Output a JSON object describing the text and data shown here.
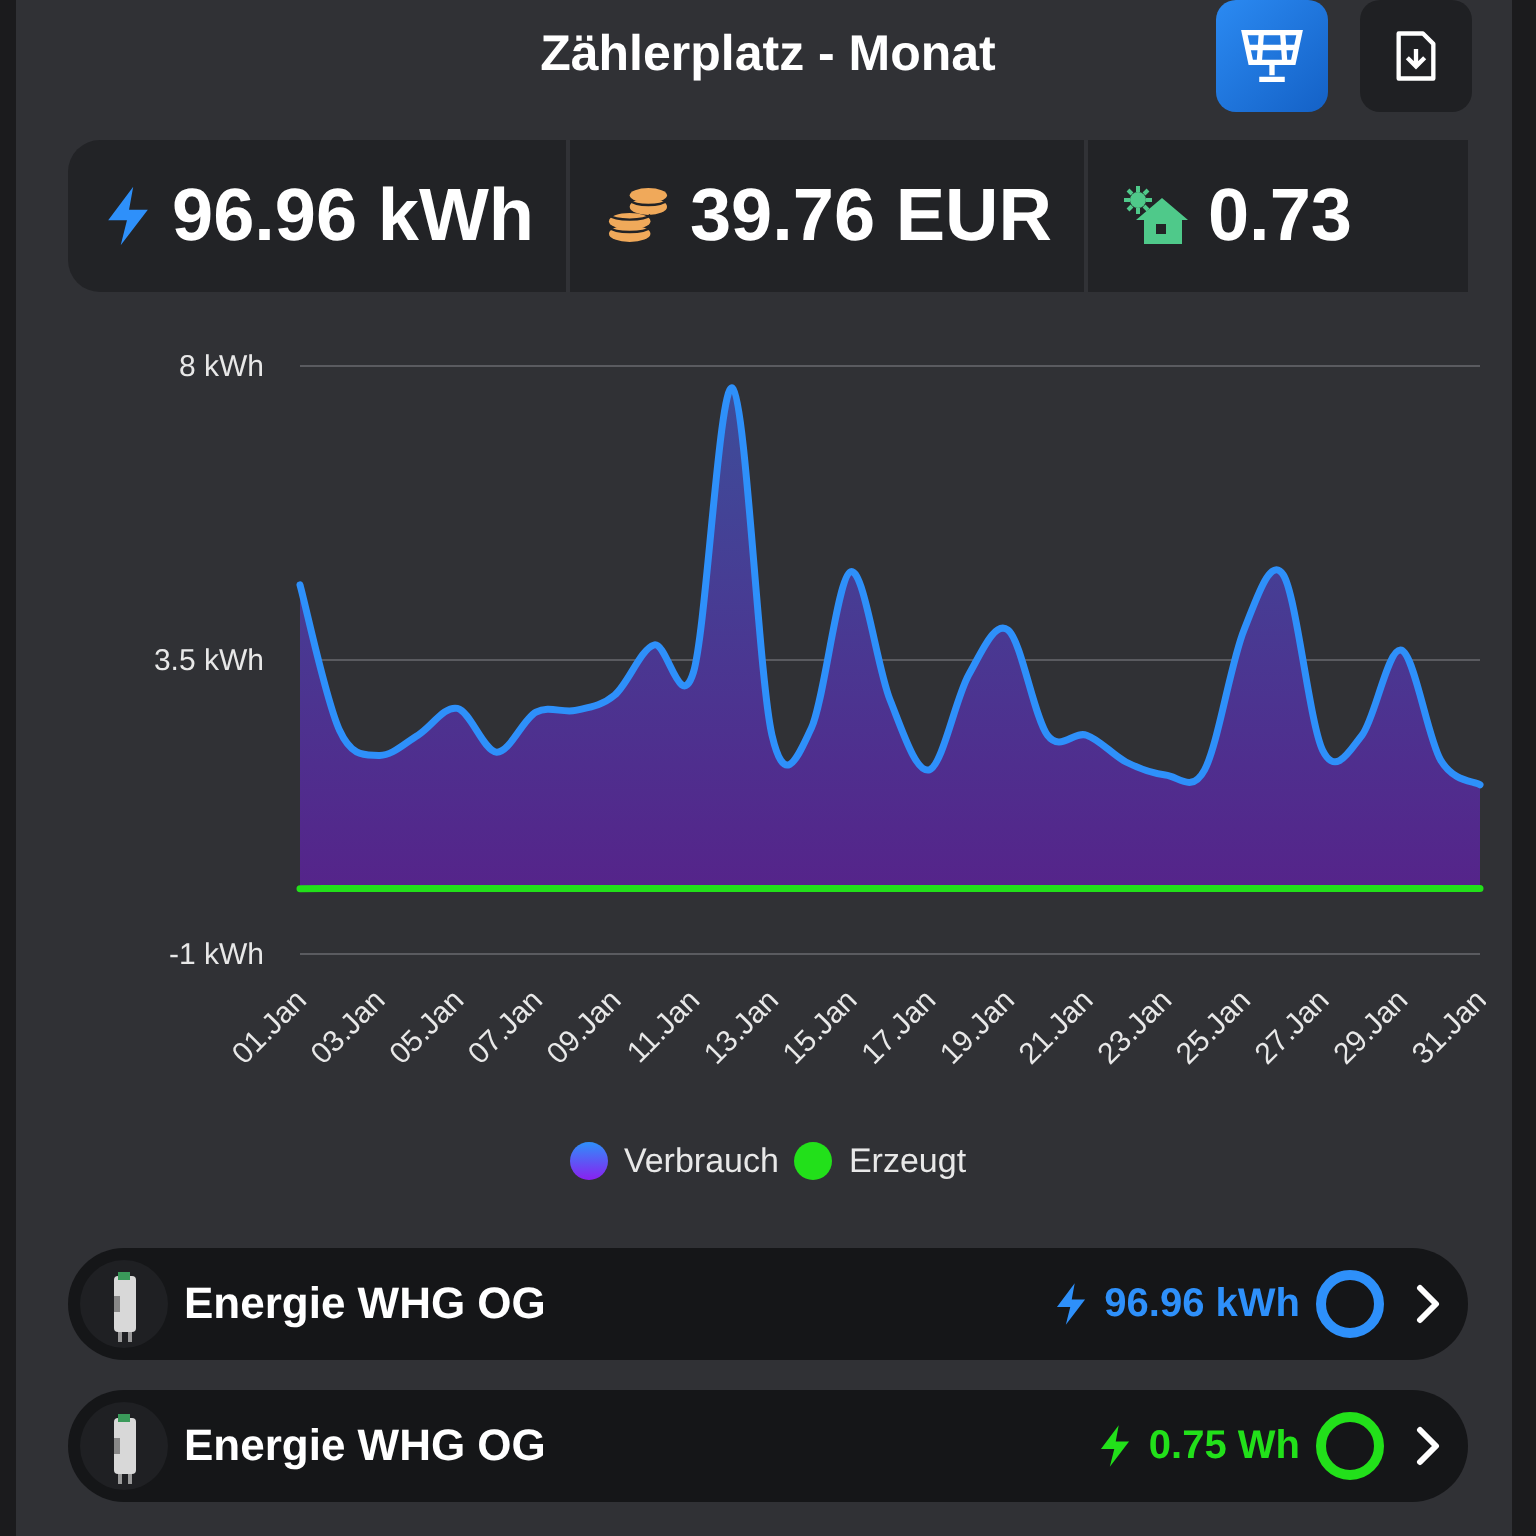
{
  "header": {
    "title": "Zählerplatz - Monat",
    "buttons": [
      {
        "kind": "solar",
        "selected": true
      },
      {
        "kind": "download",
        "selected": false
      }
    ]
  },
  "stats": [
    {
      "kind": "energy",
      "value": "96.96 kWh"
    },
    {
      "kind": "cost",
      "value": "39.76 EUR"
    },
    {
      "kind": "solar-home",
      "value": "0.73"
    }
  ],
  "chart_data": {
    "type": "area",
    "categories": [
      "01.Jan",
      null,
      "03.Jan",
      null,
      "05.Jan",
      null,
      "07.Jan",
      null,
      "09.Jan",
      null,
      "11.Jan",
      null,
      "13.Jan",
      null,
      "15.Jan",
      null,
      "17.Jan",
      null,
      "19.Jan",
      null,
      "21.Jan",
      null,
      "23.Jan",
      null,
      "25.Jan",
      null,
      "27.Jan",
      null,
      "29.Jan",
      null,
      "31.Jan"
    ],
    "series": [
      {
        "name": "Verbrauch",
        "color": "#2e90fa",
        "values": [
          4.65,
          2.43,
          2.04,
          2.35,
          2.76,
          2.09,
          2.7,
          2.73,
          2.96,
          3.73,
          3.31,
          7.66,
          2.35,
          2.46,
          4.85,
          2.89,
          1.82,
          3.27,
          3.96,
          2.35,
          2.35,
          1.94,
          1.74,
          1.82,
          3.96,
          4.8,
          2.12,
          2.35,
          3.65,
          1.97,
          1.59
        ]
      },
      {
        "name": "Erzeugt",
        "color": "#22e01a",
        "values": [
          0,
          0,
          0,
          0,
          0,
          0,
          0,
          0,
          0,
          0,
          0,
          0,
          0,
          0,
          0,
          0,
          0,
          0,
          0,
          0,
          0,
          0,
          0,
          0,
          0,
          0,
          0,
          0,
          0,
          0,
          0
        ]
      }
    ],
    "ylim": [
      -1,
      8
    ],
    "yticks": [
      {
        "value": 8,
        "label": "8 kWh"
      },
      {
        "value": 3.5,
        "label": "3.5 kWh"
      },
      {
        "value": -1,
        "label": "-1 kWh"
      }
    ]
  },
  "meters": [
    {
      "name": "Energie WHG OG",
      "value": "96.96 kWh",
      "color": "#2e90fa"
    },
    {
      "name": "Energie WHG OG",
      "value": "0.75 Wh",
      "color": "#22e01a"
    }
  ]
}
